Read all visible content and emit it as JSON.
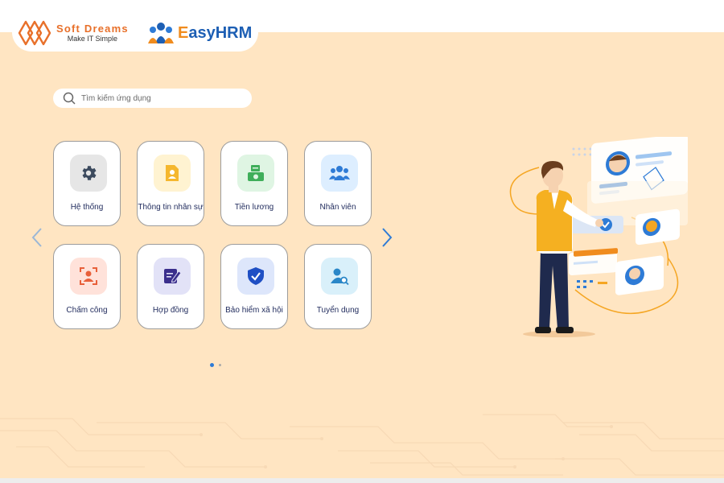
{
  "brand": {
    "name": "Soft Dreams",
    "tagline": "Make IT Simple"
  },
  "product": {
    "prefix": "E",
    "rest": "asyHRM"
  },
  "search": {
    "placeholder": "Tìm kiếm ứng dụng"
  },
  "apps": [
    {
      "label": "Hệ thống",
      "icon": "gear-icon"
    },
    {
      "label": "Thông tin nhân sự",
      "icon": "profile-document-icon"
    },
    {
      "label": "Tiền lương",
      "icon": "money-icon"
    },
    {
      "label": "Nhân viên",
      "icon": "team-icon"
    },
    {
      "label": "Chấm công",
      "icon": "face-scan-icon"
    },
    {
      "label": "Hợp đồng",
      "icon": "contract-edit-icon"
    },
    {
      "label": "Bảo hiểm xã hội",
      "icon": "shield-check-icon"
    },
    {
      "label": "Tuyển dụng",
      "icon": "recruitment-search-icon"
    }
  ],
  "pagination": {
    "total": 2,
    "current": 1
  },
  "colors": {
    "background": "#FFE5C2",
    "brand_orange": "#E8702A",
    "brand_blue": "#1D5FB4",
    "accent_blue": "#2E7BD6"
  }
}
